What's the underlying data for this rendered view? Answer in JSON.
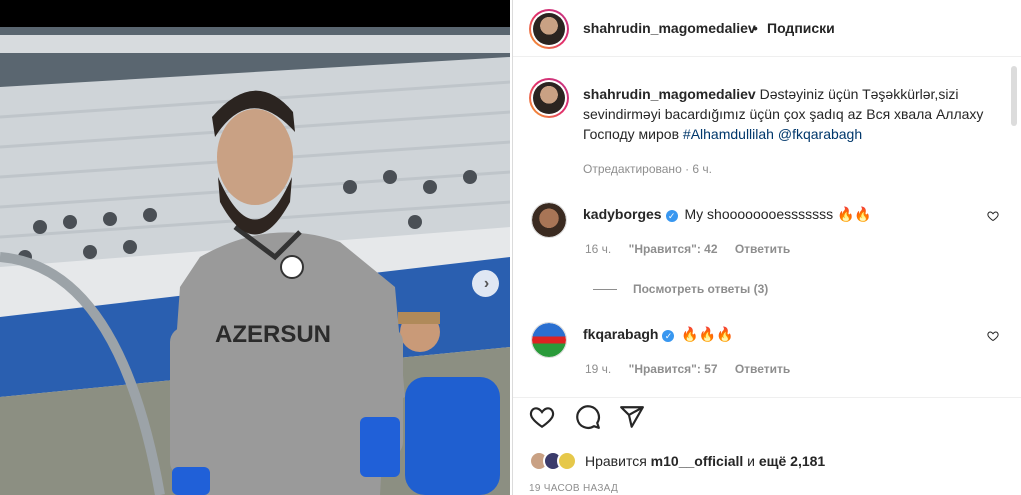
{
  "post": {
    "author": "shahrudin_magomedaliev",
    "separator": "•",
    "follow_label": "Подписки"
  },
  "caption": {
    "username": "shahrudin_magomedaliev",
    "text": "Dəstəyiniz üçün Təşəkkürlər,sizi sevindirməyi bacardığımız üçün çox şadıq az Вся хвала Аллаху Господу миров",
    "hashtag": "#Alhamdullilah",
    "mention": "@fkqarabagh",
    "edited_meta": "Отредактировано · 6 ч."
  },
  "comments": [
    {
      "username": "kadyborges",
      "verified": true,
      "text": "My shoooooooesssssss 🔥🔥",
      "time": "16 ч.",
      "likes": "\"Нравится\": 42",
      "reply_label": "Ответить"
    },
    {
      "username": "fkqarabagh",
      "verified": true,
      "text": "🔥🔥🔥",
      "time": "19 ч.",
      "likes": "\"Нравится\": 57",
      "reply_label": "Ответить"
    }
  ],
  "view_replies": "Посмотреть ответы (3)",
  "likes_line": {
    "prefix": "Нравится",
    "user": "m10__officiall",
    "middle": "и",
    "rest": "ещё 2,181"
  },
  "timestamp": "19 ЧАСОВ НАЗАД",
  "icons": {
    "like": "heart-icon",
    "comment": "comment-icon",
    "share": "paper-plane-icon",
    "next": "chevron-right-icon",
    "verified": "verified-badge-icon"
  },
  "photo": {
    "jersey_text": "AZERSUN",
    "colors": {
      "jersey": "#9a9a9a",
      "stadium_blue": "#2a5fb0",
      "seats": "#d9dde0"
    }
  }
}
